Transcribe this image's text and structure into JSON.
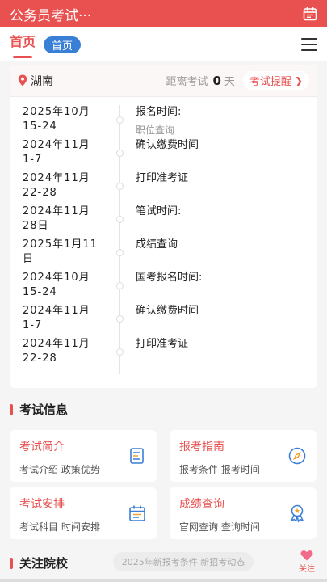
{
  "topbar": {
    "title": "公务员考试···",
    "icon": "calendar-icon"
  },
  "tabs": {
    "home": "首页",
    "pill": "首页"
  },
  "exam_card": {
    "location": "湖南",
    "countdown_label": "距离考试",
    "countdown_value": "0",
    "countdown_unit": "天",
    "remind_label": "考试提醒",
    "timeline": [
      {
        "date": "2025年10月\n15-24",
        "event": "报名时间:",
        "sub": "职位查询"
      },
      {
        "date": "2024年11月\n1-7",
        "event": "确认缴费时间",
        "sub": ""
      },
      {
        "date": "2024年11月\n22-28",
        "event": "打印准考证",
        "sub": ""
      },
      {
        "date": "2024年11月\n28日",
        "event": "笔试时间:",
        "sub": ""
      },
      {
        "date": "2025年1月11\n日",
        "event": "成绩查询",
        "sub": ""
      },
      {
        "date": "2024年10月\n15-24",
        "event": "国考报名时间:",
        "sub": ""
      },
      {
        "date": "2024年11月\n1-7",
        "event": "确认缴费时间",
        "sub": ""
      },
      {
        "date": "2024年11月\n22-28",
        "event": "打印准考证",
        "sub": ""
      }
    ]
  },
  "exam_info": {
    "title": "考试信息",
    "cards": [
      {
        "title": "考试简介",
        "desc": "考试介绍 政策优势",
        "icon": "document-icon"
      },
      {
        "title": "报考指南",
        "desc": "报考条件 报考时间",
        "icon": "compass-icon"
      },
      {
        "title": "考试安排",
        "desc": "考试科目 时间安排",
        "icon": "schedule-icon"
      },
      {
        "title": "成绩查询",
        "desc": "官网查询 查询时间",
        "icon": "award-icon"
      }
    ]
  },
  "follow_section": {
    "title": "关注院校",
    "hint": "2025年新报考条件 新招考动态",
    "follow_label": "关注",
    "follow_icon": "heart-icon"
  },
  "colors": {
    "primary": "#e8514f",
    "pill": "#3a7fd6"
  }
}
